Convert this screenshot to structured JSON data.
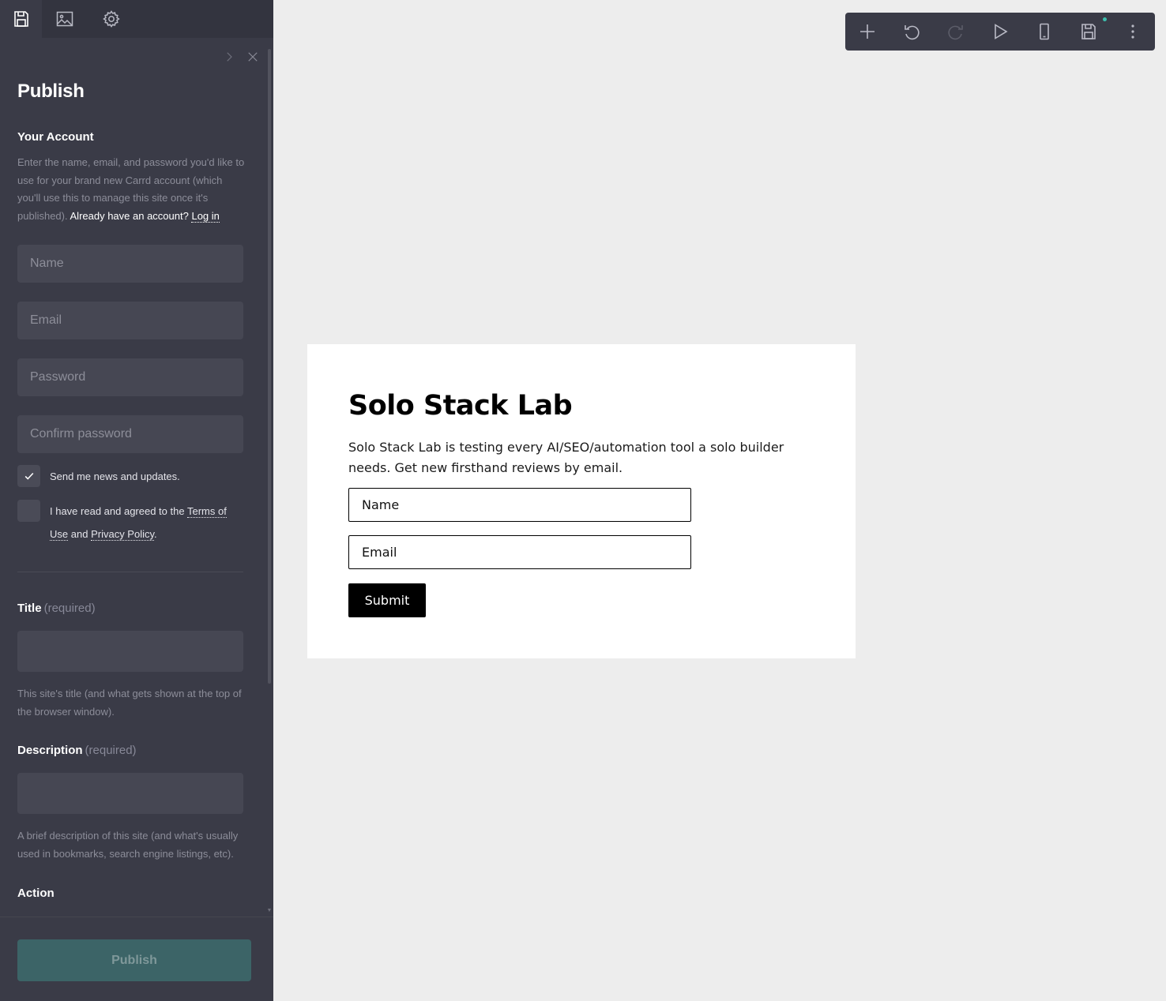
{
  "sidebar": {
    "tabs": [
      {
        "name": "publish",
        "icon": "save-icon",
        "active": true
      },
      {
        "name": "media",
        "icon": "image-icon",
        "active": false
      },
      {
        "name": "settings",
        "icon": "gear-icon",
        "active": false
      }
    ],
    "panel": {
      "title": "Publish",
      "account": {
        "heading": "Your Account",
        "help_text": "Enter the name, email, and password you'd like to use for your brand new Carrd account (which you'll use this to manage this site once it's published).",
        "already_text": "Already have an account?",
        "login_link": "Log in",
        "name_placeholder": "Name",
        "email_placeholder": "Email",
        "password_placeholder": "Password",
        "confirm_placeholder": "Confirm password",
        "newsletter_label": "Send me news and updates.",
        "newsletter_checked": true,
        "terms_prefix": "I have read and agreed to the",
        "terms_link": "Terms of Use",
        "terms_and": "and",
        "privacy_link": "Privacy Policy",
        "terms_suffix": ".",
        "terms_checked": false
      },
      "title_field": {
        "label": "Title",
        "required": "(required)",
        "value": "",
        "help": "This site's title (and what gets shown at the top of the browser window)."
      },
      "description_field": {
        "label": "Description",
        "required": "(required)",
        "value": "",
        "help": "A brief description of this site (and what's usually used in bookmarks, search engine listings, etc)."
      },
      "action_heading": "Action",
      "publish_button": "Publish"
    }
  },
  "toolbar": {
    "buttons": [
      "add-icon",
      "undo-icon",
      "redo-icon",
      "preview-play-icon",
      "mobile-view-icon",
      "save-icon",
      "more-menu-icon"
    ],
    "save_status_color": "#3cbfae"
  },
  "canvas": {
    "title": "Solo Stack Lab",
    "description": "Solo Stack Lab is testing every AI/SEO/automation tool a solo builder needs. Get new firsthand reviews by email.",
    "name_placeholder": "Name",
    "email_placeholder": "Email",
    "submit_label": "Submit"
  },
  "colors": {
    "sidebar_bg": "#3a3b47",
    "canvas_bg": "#ededed",
    "publish_button_bg": "#3c6467",
    "field_bg": "#464753"
  }
}
